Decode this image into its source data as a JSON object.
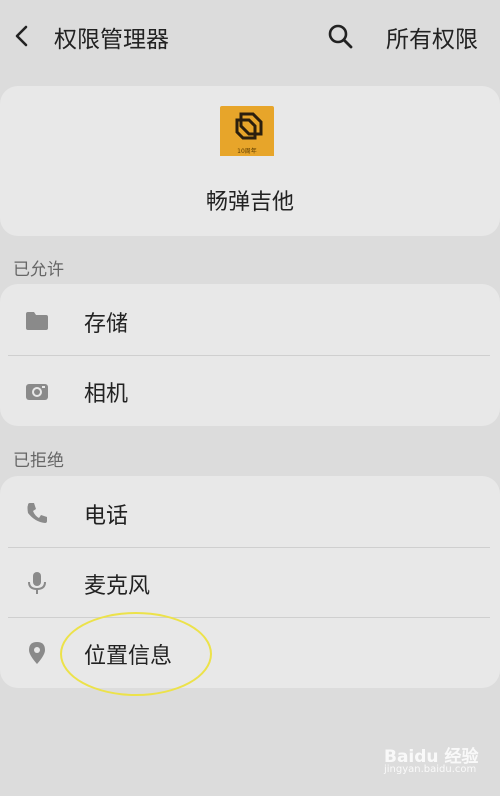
{
  "header": {
    "title": "权限管理器",
    "all_permissions": "所有权限",
    "back_icon": "chevron-left-icon",
    "search_icon": "search-icon"
  },
  "app": {
    "name": "畅弹吉他",
    "logo_badge": "10周年",
    "logo_color": "#e7a52a"
  },
  "allowed": {
    "title": "已允许",
    "items": [
      {
        "label": "存储",
        "icon": "folder-icon"
      },
      {
        "label": "相机",
        "icon": "camera-icon"
      }
    ]
  },
  "denied": {
    "title": "已拒绝",
    "items": [
      {
        "label": "电话",
        "icon": "phone-icon"
      },
      {
        "label": "麦克风",
        "icon": "microphone-icon"
      },
      {
        "label": "位置信息",
        "icon": "location-pin-icon"
      }
    ]
  },
  "annotation_color": "#ece24a",
  "watermark": {
    "main": "Baidu 经验",
    "sub": "jingyan.baidu.com"
  }
}
